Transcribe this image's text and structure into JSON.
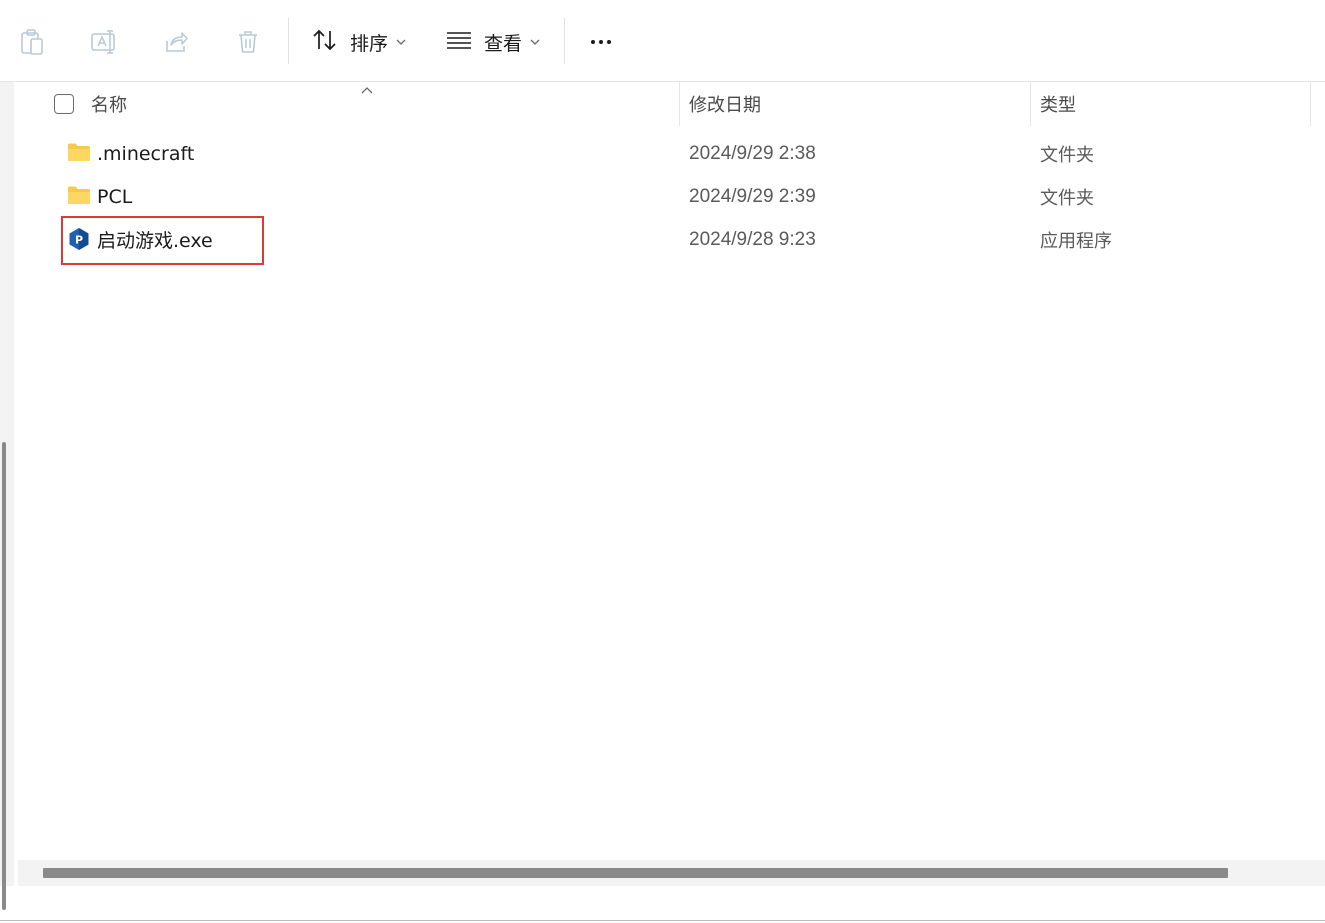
{
  "toolbar": {
    "icons": [
      "paste-icon",
      "rename-icon",
      "share-icon",
      "delete-icon"
    ],
    "sort_label": "排序",
    "view_label": "查看"
  },
  "columns": {
    "name": "名称",
    "modified": "修改日期",
    "type": "类型"
  },
  "files": [
    {
      "name": ".minecraft",
      "modified": "2024/9/29 2:38",
      "type": "文件夹",
      "icon": "folder-icon"
    },
    {
      "name": "PCL",
      "modified": "2024/9/29 2:39",
      "type": "文件夹",
      "icon": "folder-icon"
    },
    {
      "name": "启动游戏.exe",
      "modified": "2024/9/28 9:23",
      "type": "应用程序",
      "icon": "app-icon"
    }
  ],
  "colors": {
    "highlight": "#d93a3a",
    "folder": "#f8c94a",
    "app_icon": "#1f5fb5"
  }
}
